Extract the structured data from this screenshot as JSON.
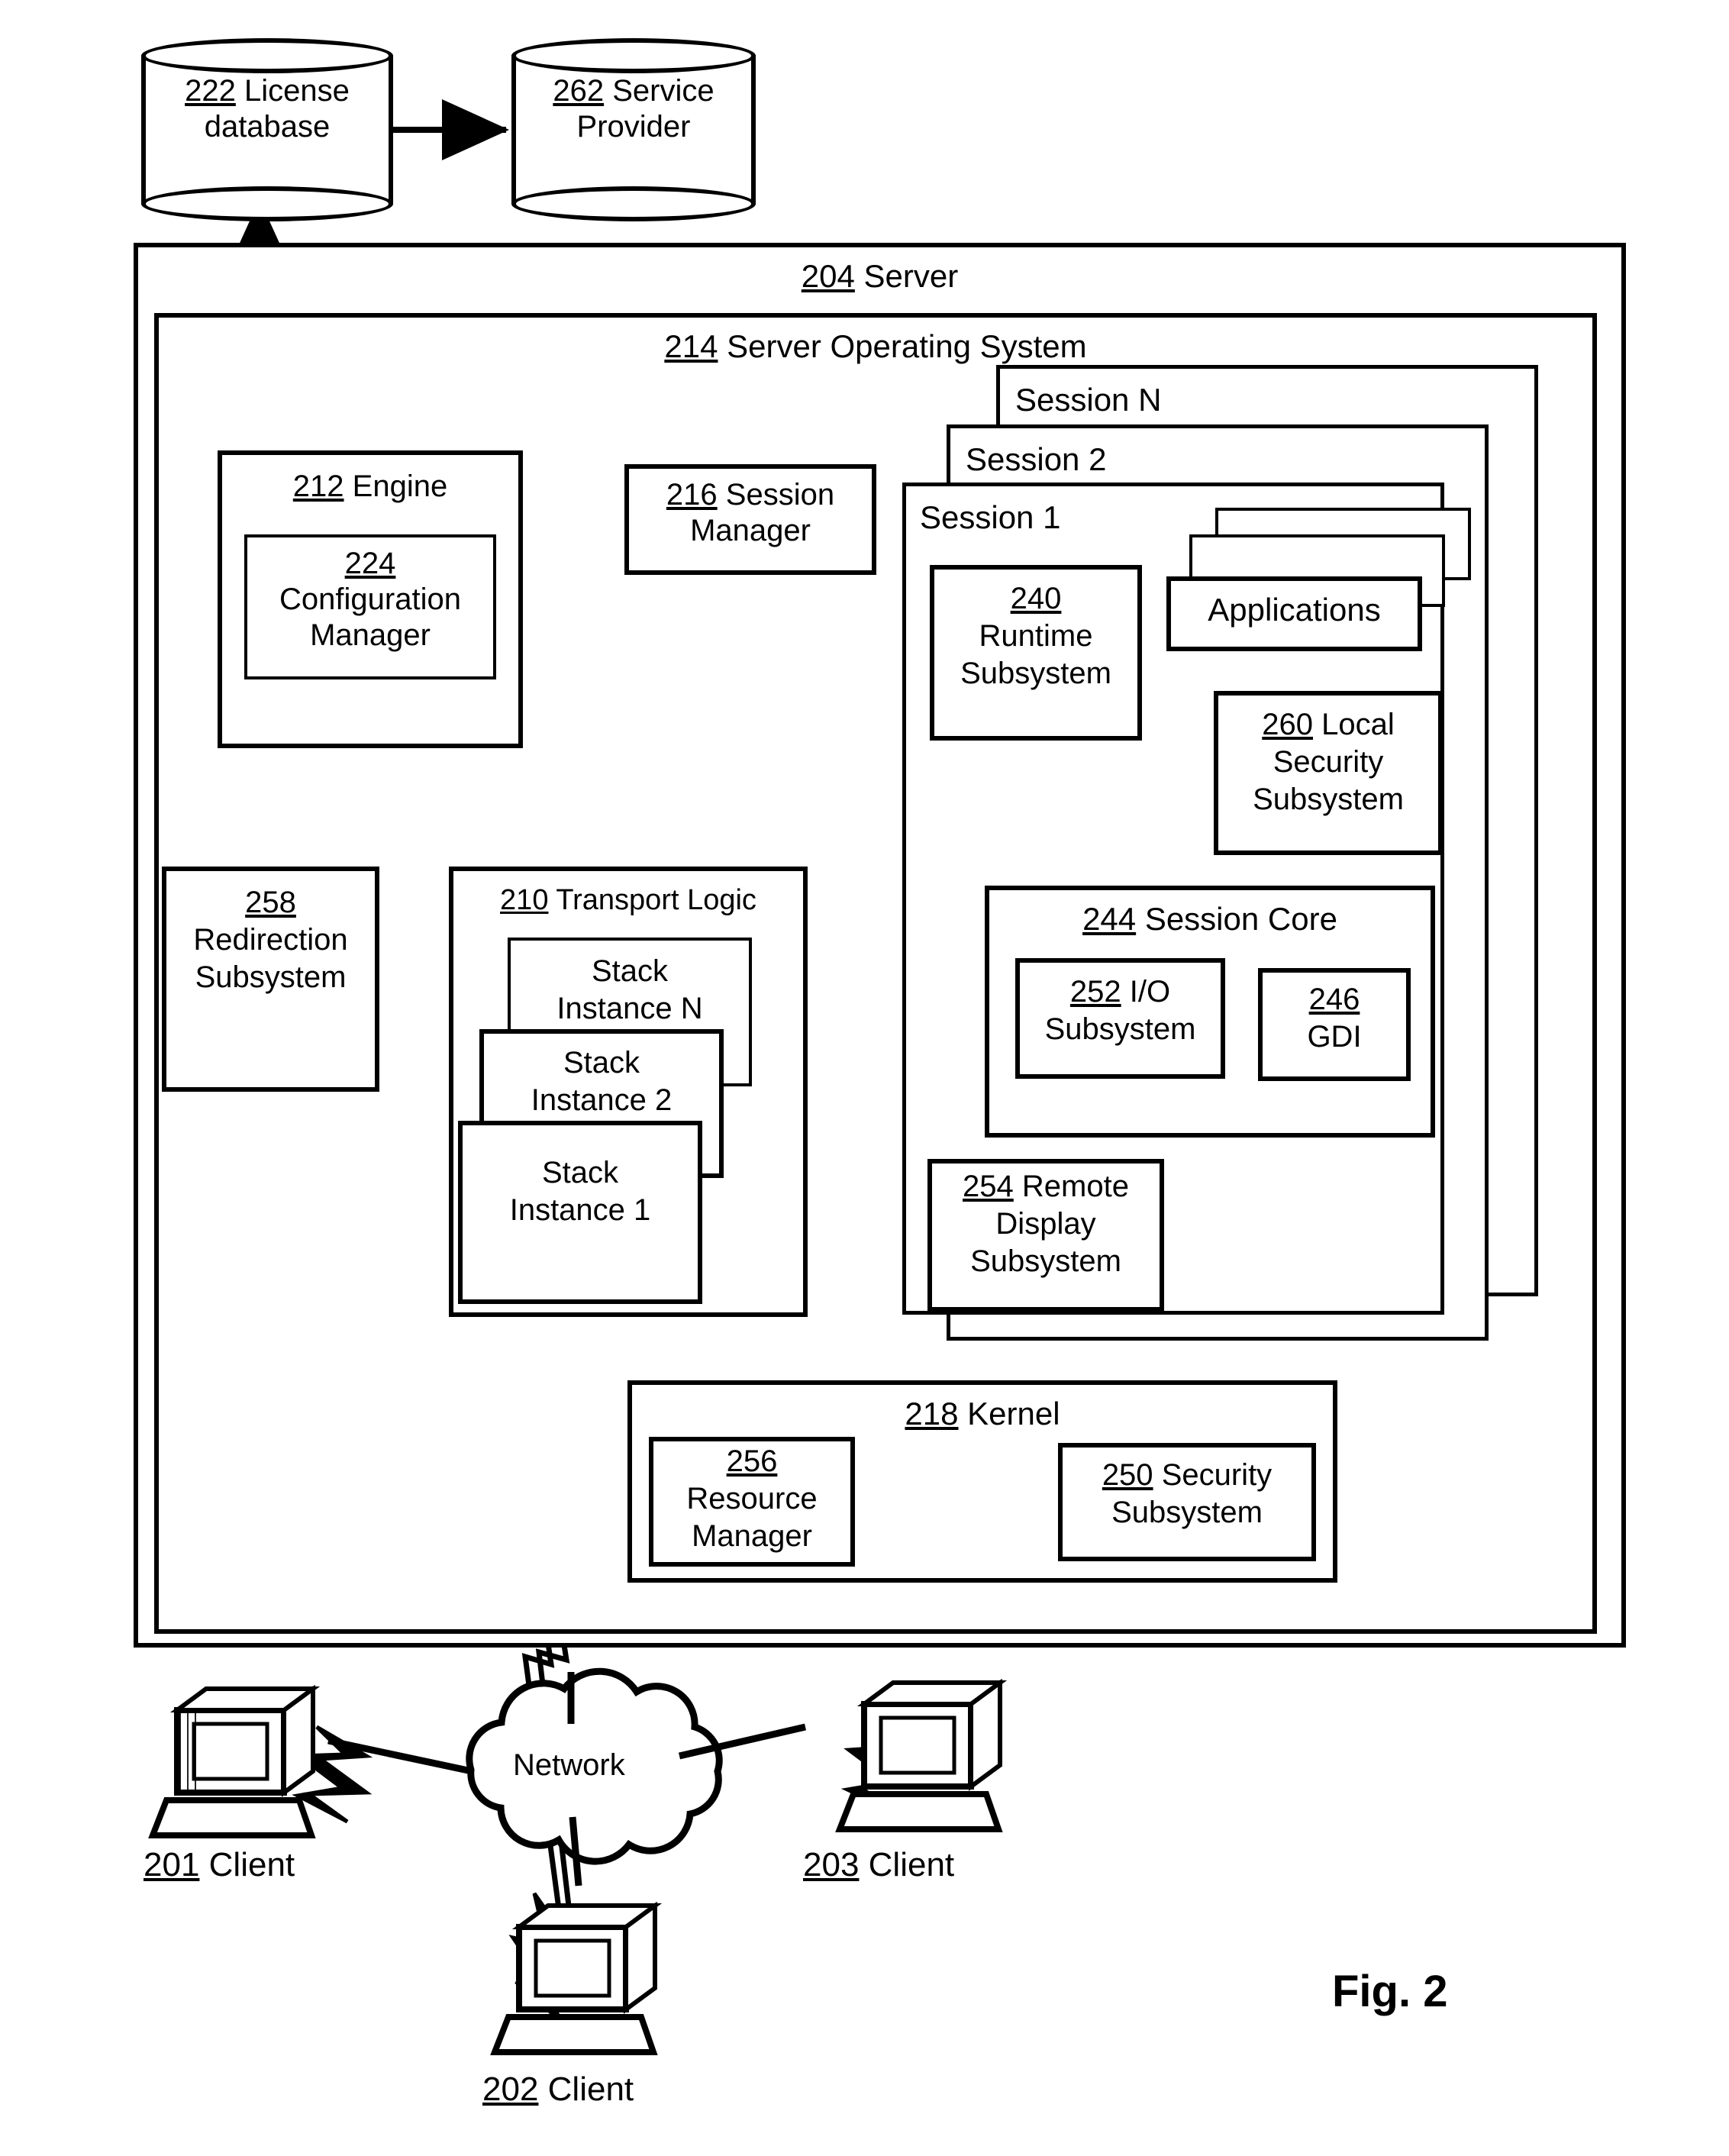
{
  "figure": {
    "label": "Fig. 2"
  },
  "datastores": [
    {
      "num": "222",
      "name": "License",
      "name2": "database"
    },
    {
      "num": "262",
      "name": "Service",
      "name2": "Provider"
    }
  ],
  "server": {
    "num": "204",
    "title": "Server",
    "os": {
      "num": "214",
      "title": "Server Operating System"
    },
    "engine": {
      "num": "212",
      "title": "Engine",
      "config_manager": {
        "num": "224",
        "line1": "Configuration",
        "line2": "Manager"
      }
    },
    "session_manager": {
      "num": "216",
      "line1": "Session",
      "line2": "Manager"
    },
    "redirection": {
      "num": "258",
      "line1": "Redirection",
      "line2": "Subsystem"
    },
    "transport_logic": {
      "num": "210",
      "title": "Transport Logic",
      "stacks": [
        {
          "line1": "Stack",
          "line2": "Instance N"
        },
        {
          "line1": "Stack",
          "line2": "Instance 2"
        },
        {
          "line1": "Stack",
          "line2": "Instance 1"
        }
      ]
    },
    "sessions": [
      {
        "label": "Session N"
      },
      {
        "label": "Session 2"
      },
      {
        "label": "Session 1"
      }
    ],
    "session1": {
      "label": "Session 1",
      "runtime": {
        "num": "240",
        "line1": "Runtime",
        "line2": "Subsystem"
      },
      "applications": {
        "label": "Applications"
      },
      "local_security": {
        "num": "260",
        "line1": "Local",
        "line2": "Security",
        "line3": "Subsystem"
      },
      "session_core": {
        "num": "244",
        "title": "Session Core",
        "io": {
          "num": "252",
          "line1": "I/O",
          "line2": "Subsystem"
        },
        "gdi": {
          "num": "246",
          "label": "GDI"
        }
      },
      "remote_display": {
        "num": "254",
        "line1": "Remote",
        "line2": "Display",
        "line3": "Subsystem"
      }
    },
    "kernel": {
      "num": "218",
      "title": "Kernel",
      "resource_manager": {
        "num": "256",
        "line1": "Resource",
        "line2": "Manager"
      },
      "security_subsystem": {
        "num": "250",
        "line1": "Security",
        "line2": "Subsystem"
      }
    }
  },
  "network": {
    "label": "Network"
  },
  "clients": [
    {
      "num": "201",
      "label": "Client"
    },
    {
      "num": "202",
      "label": "Client"
    },
    {
      "num": "203",
      "label": "Client"
    }
  ]
}
